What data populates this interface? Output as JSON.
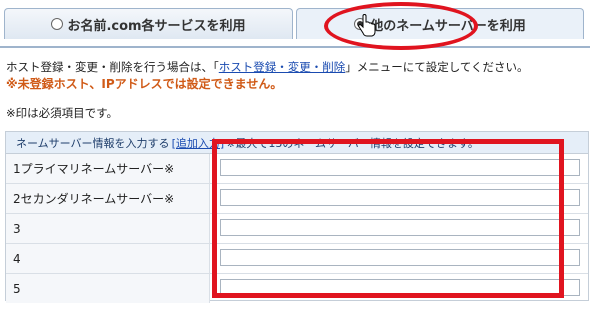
{
  "tabs": [
    {
      "label": "お名前.com各サービスを利用",
      "selected": false
    },
    {
      "label": "他のネームサーバーを利用",
      "selected": true
    }
  ],
  "info": {
    "prefix": "ホスト登録・変更・削除を行う場合は、「",
    "link": "ホスト登録・変更・削除",
    "suffix": "」メニューにて設定してください。"
  },
  "warning": "※未登録ホスト、IPアドレスでは設定できません。",
  "required_note": "※印は必須項目です。",
  "table": {
    "head_prefix": "ネームサーバー情報を入力する",
    "head_link": "[追加入力]",
    "head_suffix": "※最大で13のネームサーバー情報を設定できます。",
    "rows": [
      {
        "label": "1プライマリネームサーバー※",
        "value": ""
      },
      {
        "label": "2セカンダリネームサーバー※",
        "value": ""
      },
      {
        "label": "3",
        "value": ""
      },
      {
        "label": "4",
        "value": ""
      },
      {
        "label": "5",
        "value": ""
      }
    ]
  },
  "colors": {
    "annotation": "#e0141f",
    "warning": "#d05a17",
    "link": "#1a4bb0"
  }
}
